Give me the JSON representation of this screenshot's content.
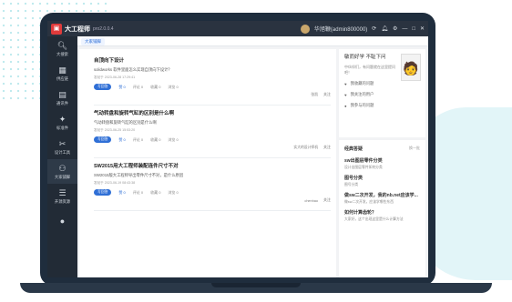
{
  "window": {
    "app_name": "大工程师",
    "version": "pro2.0.0.4",
    "user": "华旭鞭(admin800000)"
  },
  "tab": {
    "label": "大家铺脚"
  },
  "sidebar": {
    "items": [
      {
        "label": "大搜索",
        "icon": "search-icon"
      },
      {
        "label": "供应链",
        "icon": "building-icon"
      },
      {
        "label": "通讯件",
        "icon": "chat-icon"
      },
      {
        "label": "标准件",
        "icon": "bolt-icon"
      },
      {
        "label": "设计工具",
        "icon": "tools-icon"
      },
      {
        "label": "大家铺脚",
        "icon": "team-icon"
      },
      {
        "label": "开源资源",
        "icon": "layers-icon"
      },
      {
        "label": "",
        "icon": "message-icon"
      }
    ]
  },
  "feed": {
    "items": [
      {
        "title": "自顶向下设计",
        "excerpt": "solidworks 软件里面怎么实现自顶向下设计？",
        "meta": "发帖于 2023-06-28 17:29:41",
        "answer_btn": "写回答",
        "likes": "赞 0",
        "comments": "评论 0",
        "favorites": "收藏 0",
        "views": "浏览 0",
        "owner": "张凯",
        "follow": "关注"
      },
      {
        "title": "气动转盘和旋转气缸的区别是什么啊",
        "excerpt": "气动转盘和旋转气缸的区别是什么啊",
        "meta": "发帖于 2023-06-25 15:53:20",
        "answer_btn": "写回答",
        "likes": "赞 0",
        "comments": "评论 0",
        "favorites": "收藏 0",
        "views": "浏览 0",
        "owner": "实大的设计师机",
        "follow": "关注"
      },
      {
        "title": "SW2015用大工程师装配连件尺寸不对",
        "excerpt": "SW2015版大工程师导出零件尺寸不对，是什么原因",
        "meta": "发帖于 2023-06-19 08:43:38",
        "answer_btn": "写回答",
        "likes": "赞 0",
        "comments": "评论 0",
        "favorites": "收藏 0",
        "views": "浏览 0",
        "owner": "chenhao",
        "follow": "关注"
      }
    ]
  },
  "profile": {
    "title": "敏而好学 不耻下问",
    "subtitle": "中伙伴们，有问题就在这里提问吧！",
    "links": [
      "我收藏的问题",
      "我关注的用户",
      "我参与的问题"
    ]
  },
  "featured": {
    "heading": "经典答疑",
    "more": "换一批",
    "items": [
      {
        "title": "sw出图层零件分类",
        "sub": "设计出图层零件如何分类"
      },
      {
        "title": "图号分类",
        "sub": "图号分类"
      },
      {
        "title": "做sw二次开发，我的nb.net应该学...",
        "sub": "做sw二次开发，应该学哪些东西"
      },
      {
        "title": "如何计算齿轮？",
        "sub": "大家好，这个出现这里是什么计算方法"
      }
    ]
  }
}
